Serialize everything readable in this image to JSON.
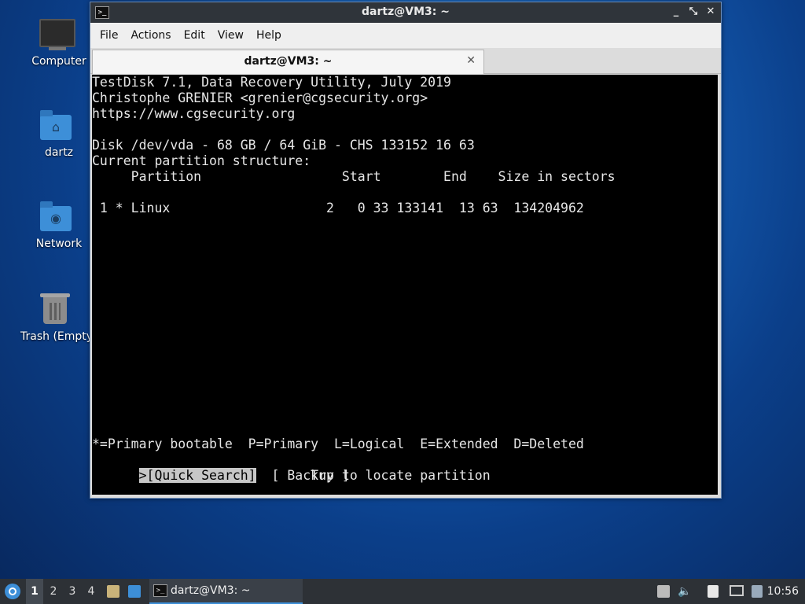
{
  "desktop": {
    "icons": [
      {
        "label": "Computer",
        "icon": "computer-icon"
      },
      {
        "label": "dartz",
        "icon": "home-folder-icon"
      },
      {
        "label": "Network",
        "icon": "network-folder-icon"
      },
      {
        "label": "Trash (Empty)",
        "icon": "trash-icon"
      }
    ]
  },
  "window": {
    "title": "dartz@VM3: ~",
    "buttons": {
      "minimize": "_",
      "maximize": "⤡",
      "close": "✕"
    },
    "menu": [
      "File",
      "Actions",
      "Edit",
      "View",
      "Help"
    ],
    "tab": {
      "label": "dartz@VM3: ~",
      "close": "✕"
    }
  },
  "terminal": {
    "header": [
      "TestDisk 7.1, Data Recovery Utility, July 2019",
      "Christophe GRENIER <grenier@cgsecurity.org>",
      "https://www.cgsecurity.org"
    ],
    "disk_line": "Disk /dev/vda - 68 GB / 64 GiB - CHS 133152 16 63",
    "structure_label": "Current partition structure:",
    "columns": "     Partition                  Start        End    Size in sectors",
    "partition_row": " 1 * Linux                    2   0 33 133141  13 63  134204962",
    "legend": "*=Primary bootable  P=Primary  L=Logical  E=Extended  D=Deleted",
    "action_selected": ">[Quick Search]",
    "action_other": "  [ Backup ]",
    "hint": "                            Try to locate partition"
  },
  "taskbar": {
    "workspaces": [
      "1",
      "2",
      "3",
      "4"
    ],
    "active_workspace": "1",
    "task_label": "dartz@VM3: ~",
    "clock": "10:56"
  },
  "colors": {
    "accent": "#3d8fd8",
    "terminal_bg": "#000000",
    "terminal_fg": "#e6e6e6",
    "selection_bg": "#c7c7c7"
  }
}
